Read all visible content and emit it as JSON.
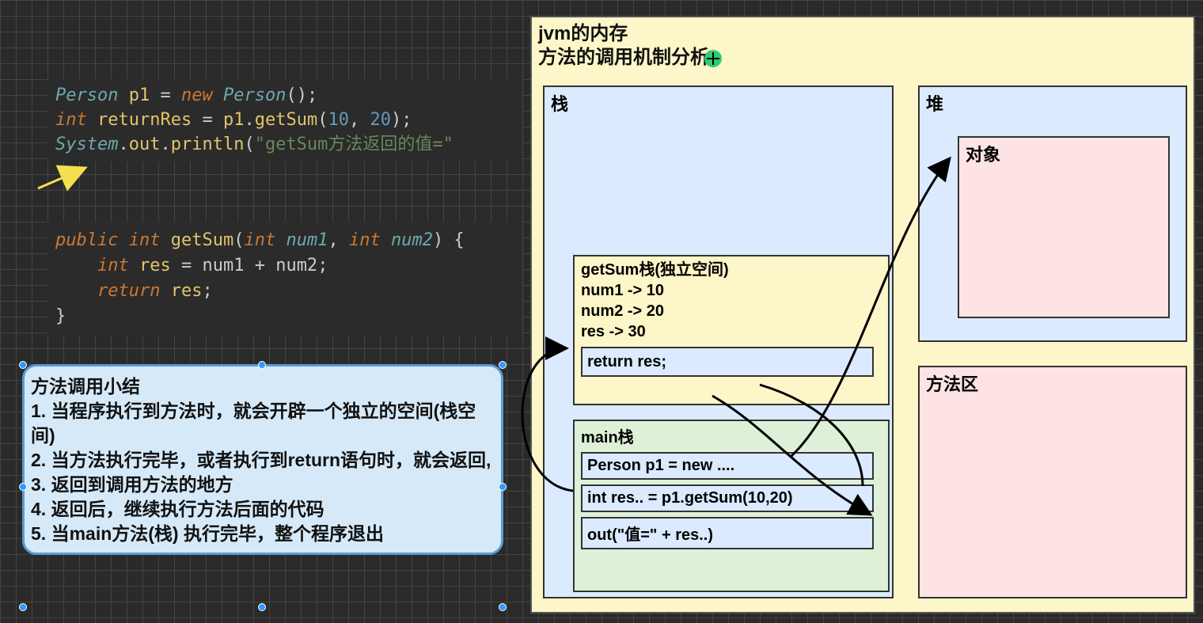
{
  "code1": {
    "line1_a": "Person",
    "line1_b": "p1",
    "line1_c": "new",
    "line1_d": "Person",
    "line2_a": "int",
    "line2_b": "returnRes",
    "line2_c": "p1",
    "line2_d": "getSum",
    "line2_n1": "10",
    "line2_n2": "20",
    "line3_a": "System",
    "line3_b": "out",
    "line3_c": "println",
    "line3_str": "\"getSum方法返回的值=\""
  },
  "code2": {
    "l1_kw": "public",
    "l1_type": "int",
    "l1_meth": "getSum",
    "l1_p1t": "int",
    "l1_p1": "num1",
    "l1_p2t": "int",
    "l1_p2": "num2",
    "l2_type": "int",
    "l2_var": "res",
    "l2_rhs": "num1 + num2",
    "l3_kw": "return",
    "l3_var": "res"
  },
  "summary": {
    "title": "方法调用小结",
    "i1": "1. 当程序执行到方法时，就会开辟一个独立的空间(栈空间)",
    "i2": "2. 当方法执行完毕，或者执行到return语句时，就会返回,",
    "i3": "3. 返回到调用方法的地方",
    "i4": "4. 返回后，继续执行方法后面的代码",
    "i5": "5. 当main方法(栈) 执行完毕，整个程序退出"
  },
  "jvm": {
    "title1": "jvm的内存",
    "title2": "方法的调用机制分析",
    "stack_label": "栈",
    "heap_label": "堆",
    "method_area_label": "方法区",
    "object_label": "对象",
    "getsum": {
      "title": "getSum栈(独立空间)",
      "l1": "num1 -> 10",
      "l2": "num2 -> 20",
      "l3": "res -> 30",
      "ret": "return res;"
    },
    "main": {
      "title": "main栈",
      "s1": "Person p1 = new ....",
      "s2": "int res.. = p1.getSum(10,20)",
      "s3": "out(\"值=\" + res..)"
    }
  }
}
